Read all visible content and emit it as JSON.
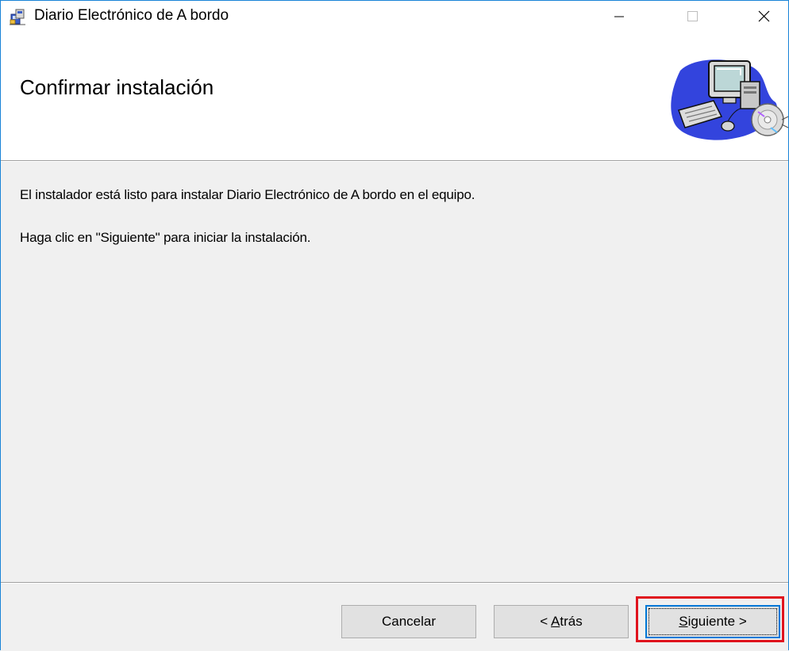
{
  "window": {
    "title": "Diario Electrónico de A bordo",
    "icon": "installer-icon",
    "controls": {
      "minimize": "minimize-icon",
      "maximize": "maximize-icon",
      "close": "close-icon"
    }
  },
  "banner": {
    "title": "Confirmar instalación",
    "graphic": "computer-cd-icon"
  },
  "body": {
    "line1": "El instalador está listo para instalar Diario Electrónico de A bordo en el equipo.",
    "line2": "Haga clic en \"Siguiente\" para iniciar la instalación."
  },
  "buttons": {
    "cancel": "Cancelar",
    "back_prefix": "< ",
    "back_accel": "A",
    "back_rest": "trás",
    "next_accel": "S",
    "next_rest": "iguiente >"
  },
  "colors": {
    "window_border": "#1883d7",
    "focus_border": "#0078d7",
    "highlight": "#e0141e"
  }
}
